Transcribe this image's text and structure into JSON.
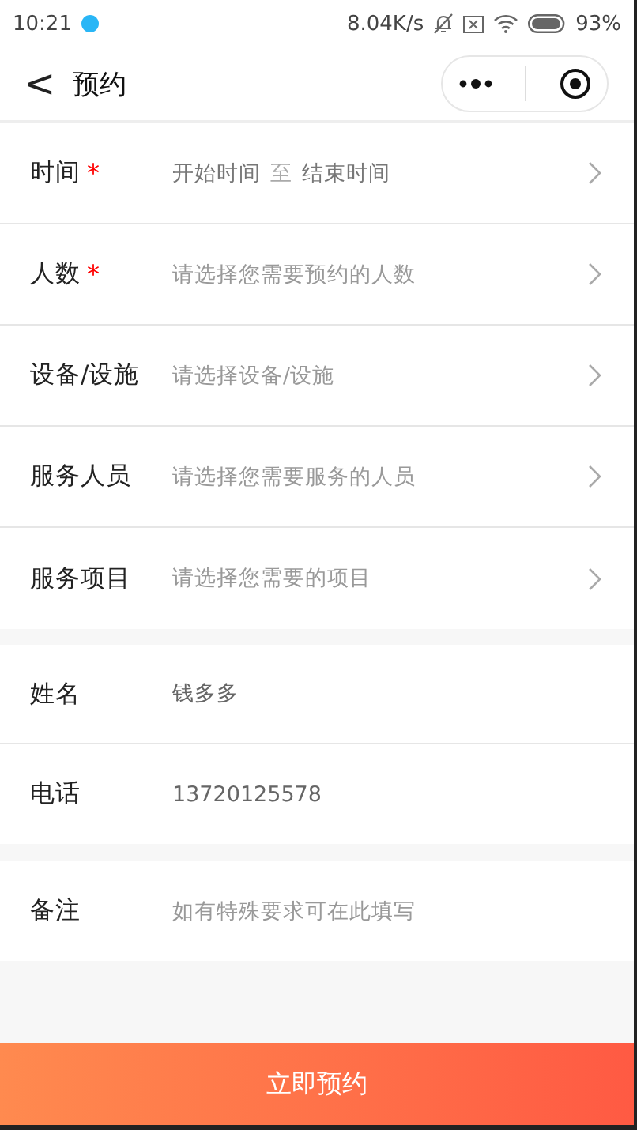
{
  "status_bar": {
    "time": "10:21",
    "speed": "8.04K/s",
    "battery": "93%"
  },
  "nav": {
    "title": "预约",
    "back": "<"
  },
  "sections": [
    {
      "rows": [
        {
          "kind": "range",
          "label": "时间",
          "mark": "*",
          "start": "开始时间",
          "separator": "至",
          "end": "结束时间"
        },
        {
          "kind": "picker",
          "label": "人数",
          "mark": "*",
          "placeholder": "请选择您需要预约的人数"
        },
        {
          "kind": "picker",
          "label": "设备/设施",
          "placeholder": "请选择设备/设施"
        },
        {
          "kind": "picker",
          "label": "服务人员",
          "placeholder": "请选择您需要服务的人员"
        },
        {
          "kind": "picker",
          "label": "服务项目",
          "placeholder": "请选择您需要的项目"
        }
      ]
    },
    {
      "rows": [
        {
          "kind": "input",
          "label": "姓名",
          "value": "钱多多"
        },
        {
          "kind": "input",
          "label": "电话",
          "value": "13720125578"
        }
      ]
    },
    {
      "rows": [
        {
          "kind": "input",
          "label": "备注",
          "placeholder": "如有特殊要求可在此填写"
        }
      ]
    }
  ],
  "submit": "立即预约"
}
